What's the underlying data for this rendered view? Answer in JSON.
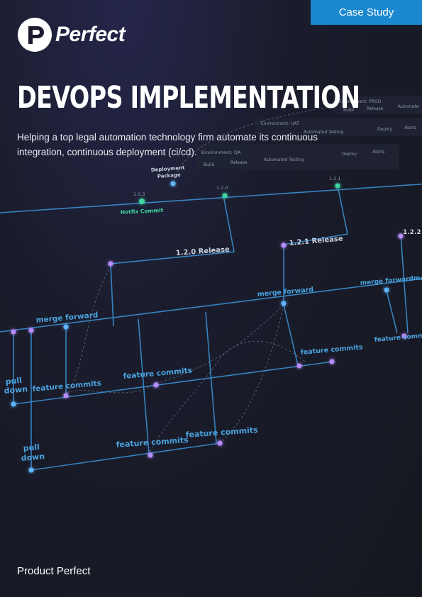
{
  "badge": {
    "label": "Case Study"
  },
  "brand": {
    "name": "Perfect"
  },
  "title": "DEVOPS IMPLEMENTATION",
  "subtitle": "Helping a top legal automation technology firm automate its continuous integration, continuous deployment (ci/cd).",
  "footer": {
    "company": "Product Perfect"
  },
  "diagram": {
    "env_prod": "Environment: PROD",
    "env_uat": "Environment: UAT",
    "env_qa": "Environment: QA",
    "step_build": "Build",
    "step_release": "Release",
    "step_automated_testing": "Automated Testing",
    "step_automated_short": "Automate",
    "step_deploy": "Deploy",
    "step_alerts": "Alerts",
    "deployment_package": "Deployment",
    "deployment_package_2": "Package",
    "v103": "1.0.3",
    "v120": "1.2.0",
    "v121": "1.2.1",
    "hotfix": "Hotfix Commit",
    "release_120": "1.2.0 Release",
    "release_121": "1.2.1 Release",
    "release_122": "1.2.2",
    "merge_forward": "merge forward",
    "merge_forward_short": "me",
    "feature_commits": "feature commits",
    "feature_commits_short": "feature commi",
    "pull": "pull",
    "down": "down"
  },
  "colors": {
    "accent": "#1a87cf",
    "line": "#3a8fd0",
    "node": "#b98cff",
    "hotfix": "#3fd6a0"
  }
}
